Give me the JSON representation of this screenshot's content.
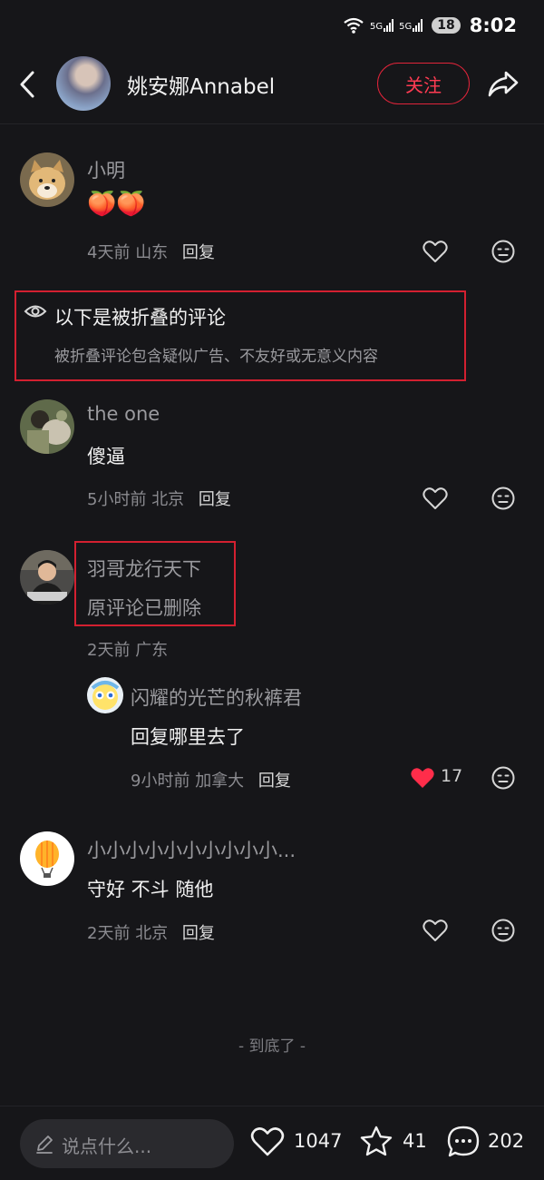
{
  "status_bar": {
    "signal1": "5G",
    "signal2": "5G",
    "signal3": "5G",
    "battery": "18",
    "time": "8:02"
  },
  "header": {
    "name": "姚安娜Annabel",
    "follow_label": "关注"
  },
  "comments": [
    {
      "name": "小明",
      "text": "🍑🍑",
      "time": "4天前",
      "location": "山东",
      "reply": "回复"
    },
    {
      "name": "the one",
      "text": "傻逼",
      "time": "5小时前",
      "location": "北京",
      "reply": "回复"
    },
    {
      "name": "羽哥龙行天下",
      "text": "原评论已删除",
      "time": "2天前",
      "location": "广东"
    },
    {
      "name": "小小小小小小小小小小...",
      "text": "守好  不斗  随他",
      "time": "2天前",
      "location": "北京",
      "reply": "回复"
    }
  ],
  "folded": {
    "title": "以下是被折叠的评论",
    "desc": "被折叠评论包含疑似广告、不友好或无意义内容"
  },
  "sub_reply": {
    "name": "闪耀的光芒的秋裤君",
    "text": "回复哪里去了",
    "time": "9小时前",
    "location": "加拿大",
    "reply": "回复",
    "likes": "17"
  },
  "end_text": "- 到底了 -",
  "bottom_bar": {
    "placeholder": "说点什么...",
    "likes": "1047",
    "stars": "41",
    "comments": "202"
  },
  "colors": {
    "accent": "#e0243a",
    "background": "#161619",
    "like_active": "#ff2d4a"
  }
}
